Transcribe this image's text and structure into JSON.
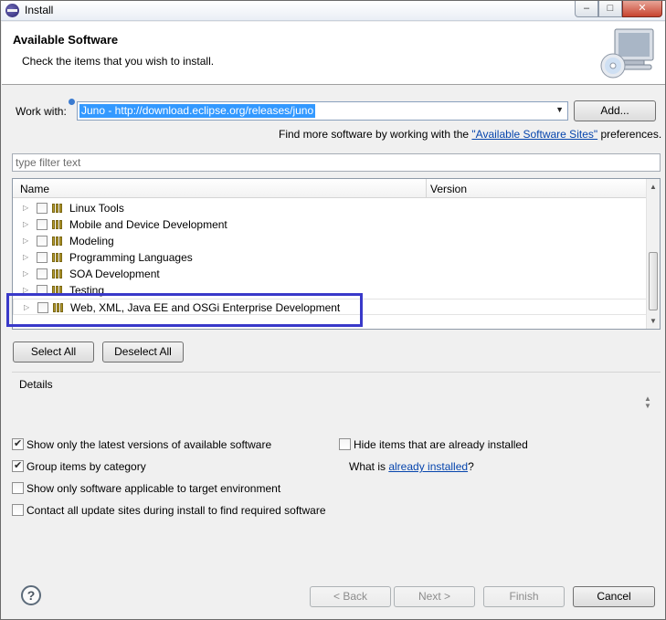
{
  "window": {
    "title": "Install"
  },
  "banner": {
    "title": "Available Software",
    "description": "Check the items that you wish to install."
  },
  "work_with": {
    "label": "Work with:",
    "value": "Juno - http://download.eclipse.org/releases/juno",
    "add_label": "Add...",
    "more_prefix": "Find more software by working with the ",
    "more_link": "\"Available Software Sites\"",
    "more_suffix": " preferences."
  },
  "filter": {
    "placeholder": "type filter text"
  },
  "tree": {
    "columns": [
      "Name",
      "Version"
    ],
    "rows": [
      {
        "label": "Linux Tools",
        "checked": false
      },
      {
        "label": "Mobile and Device Development",
        "checked": false
      },
      {
        "label": "Modeling",
        "checked": false
      },
      {
        "label": "Programming Languages",
        "checked": false
      },
      {
        "label": "SOA Development",
        "checked": false
      },
      {
        "label": "Testing",
        "checked": false
      },
      {
        "label": "Web, XML, Java EE and OSGi Enterprise Development",
        "checked": false
      }
    ]
  },
  "selection": {
    "select_all": "Select All",
    "deselect_all": "Deselect All"
  },
  "details": {
    "label": "Details"
  },
  "options": {
    "latest_versions": {
      "label": "Show only the latest versions of available software",
      "checked": true
    },
    "group_by_category": {
      "label": "Group items by category",
      "checked": true
    },
    "applicable_target": {
      "label": "Show only software applicable to target environment",
      "checked": false
    },
    "contact_update_sites": {
      "label": "Contact all update sites during install to find required software",
      "checked": false
    },
    "hide_installed": {
      "label": "Hide items that are already installed",
      "checked": false
    },
    "what_is_prefix": "What is ",
    "what_is_link": "already installed",
    "what_is_suffix": "?"
  },
  "footer": {
    "back": "< Back",
    "next": "Next >",
    "finish": "Finish",
    "cancel": "Cancel"
  },
  "icons": {
    "app": "eclipse-icon",
    "banner": "monitor-cd-icon",
    "help": "help-icon"
  },
  "colors": {
    "selection": "#3399ff",
    "highlight_border": "#3939c9",
    "link": "#0645ad"
  }
}
